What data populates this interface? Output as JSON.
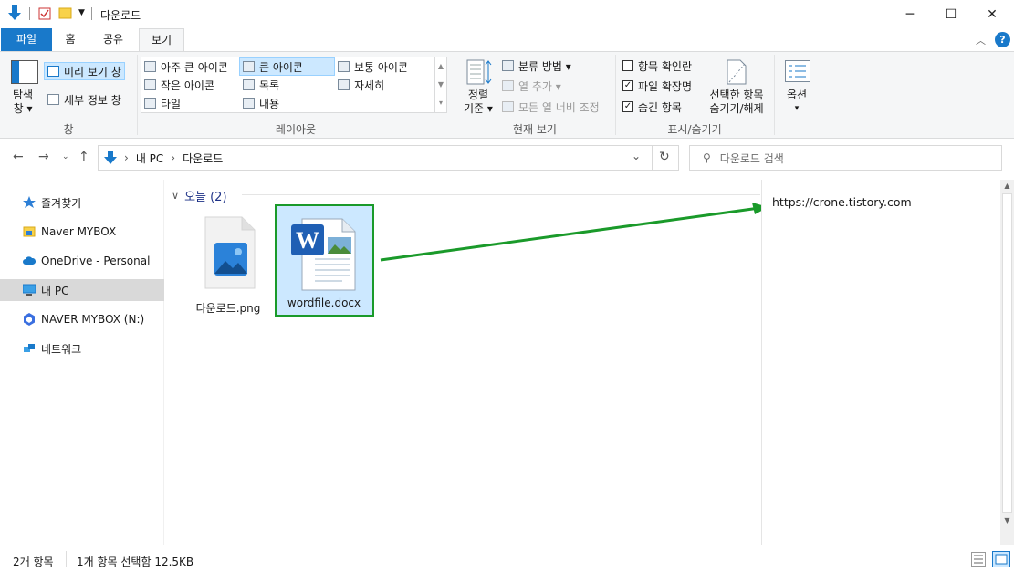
{
  "window": {
    "title": "다운로드",
    "minimize": "─",
    "maximize": "☐",
    "close": "✕"
  },
  "ribbon_tabs": [
    "파일",
    "홈",
    "공유",
    "보기"
  ],
  "help_icon": "?",
  "ribbon": {
    "panes": {
      "nav_pane": "탐색\n창",
      "nav_line1": "탐색",
      "nav_line2": "창 ▾",
      "preview_pane": "미리 보기 창",
      "details_pane": "세부 정보 창",
      "label": "창"
    },
    "layout": {
      "items": [
        "아주 큰 아이콘",
        "큰 아이콘",
        "보통 아이콘",
        "작은 아이콘",
        "목록",
        "자세히",
        "타일",
        "내용"
      ],
      "selected": "큰 아이콘",
      "label": "레이아웃"
    },
    "current_view": {
      "sort_line1": "정렬",
      "sort_line2": "기준 ▾",
      "group_by": "분류 방법 ▾",
      "add_columns": "열 추가 ▾",
      "fit_columns": "모든 열 너비 조정",
      "label": "현재 보기"
    },
    "show_hide": {
      "item_checkboxes": "항목 확인란",
      "file_ext": "파일 확장명",
      "hidden_items": "숨긴 항목",
      "hide_selected_line1": "선택한 항목",
      "hide_selected_line2": "숨기기/해제",
      "label": "표시/숨기기"
    },
    "options": {
      "line1": "옵션",
      "line2": "▾"
    }
  },
  "checkboxes": {
    "item_checkboxes": false,
    "file_ext": true,
    "hidden_items": true
  },
  "address": {
    "path": [
      "내 PC",
      "다운로드"
    ],
    "search_placeholder": "다운로드 검색"
  },
  "sidebar": {
    "items": [
      {
        "label": "즐겨찾기",
        "icon": "star-icon"
      },
      {
        "label": "Naver MYBOX",
        "icon": "folder-icon"
      },
      {
        "label": "OneDrive - Personal",
        "icon": "cloud-icon"
      },
      {
        "label": "내 PC",
        "icon": "pc-icon"
      },
      {
        "label": "NAVER MYBOX (N:)",
        "icon": "drive-icon"
      },
      {
        "label": "네트워크",
        "icon": "network-icon"
      }
    ],
    "selected": "내 PC"
  },
  "group": {
    "title": "오늘 (2)"
  },
  "files": [
    {
      "name": "다운로드.png",
      "icon": "image-file-icon",
      "selected": false
    },
    {
      "name": "wordfile.docx",
      "icon": "word-file-icon",
      "selected": true
    }
  ],
  "annotation": {
    "url": "https://crone.tistory.com",
    "color": "#1a9a2a"
  },
  "status": {
    "count": "2개 항목",
    "selection": "1개 항목 선택함 12.5KB"
  },
  "colors": {
    "accent": "#1979ca",
    "selection": "#cce8ff"
  }
}
